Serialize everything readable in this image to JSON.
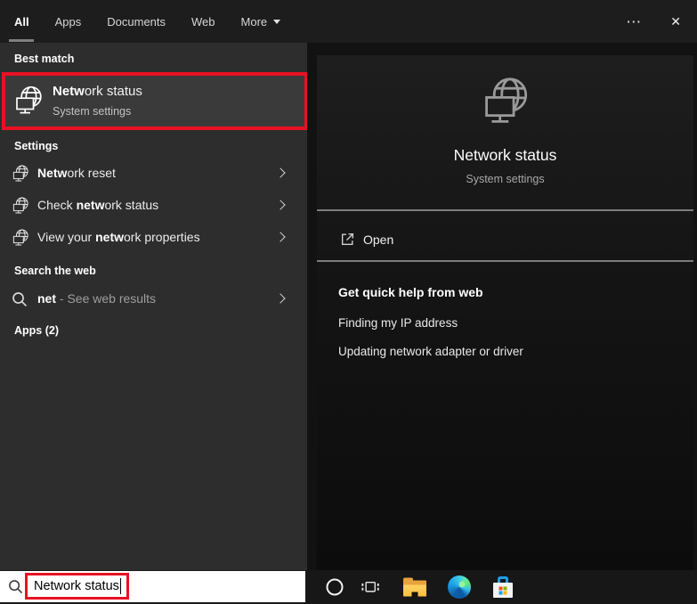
{
  "topbar": {
    "tabs": [
      {
        "label": "All",
        "active": true
      },
      {
        "label": "Apps",
        "active": false
      },
      {
        "label": "Documents",
        "active": false
      },
      {
        "label": "Web",
        "active": false
      }
    ],
    "more_label": "More",
    "ellipsis_glyph": "⋯",
    "close_glyph": "✕"
  },
  "left": {
    "best_match_header": "Best match",
    "best_match": {
      "pre": "",
      "bold": "Netw",
      "rest": "ork status",
      "sub": "System settings"
    },
    "settings_header": "Settings",
    "settings_items": [
      {
        "pre": "",
        "bold": "Netw",
        "rest": "ork reset"
      },
      {
        "pre": "Check ",
        "bold": "netw",
        "rest": "ork status"
      },
      {
        "pre": "View your ",
        "bold": "netw",
        "rest": "ork properties"
      }
    ],
    "web_header": "Search the web",
    "web_item": {
      "bold": "net",
      "rest": " - See web results"
    },
    "apps_header": "Apps (2)"
  },
  "right": {
    "title": "Network status",
    "subtitle": "System settings",
    "open_label": "Open",
    "help_header": "Get quick help from web",
    "help_links": [
      "Finding my IP address",
      "Updating network adapter or driver"
    ]
  },
  "search": {
    "value": "Network status"
  },
  "icons": [
    "network-globe-monitor-icon",
    "search-icon",
    "chevron-right-icon",
    "open-external-icon",
    "cortana-circle-icon",
    "task-view-icon",
    "file-explorer-icon",
    "edge-browser-icon",
    "microsoft-store-icon",
    "ellipsis-icon",
    "close-icon",
    "more-caret-icon"
  ],
  "colors": {
    "annotation_red": "#e81123",
    "left_panel_bg": "#2d2d2d",
    "selected_item_bg": "#3a3a3a",
    "folder_yellow": "#ffb900",
    "edge_blue": "#0c59a4",
    "store_handle_blue": "#1f9ce8",
    "ms_logo": [
      "#f25022",
      "#7fba00",
      "#00a4ef",
      "#ffb900"
    ]
  }
}
